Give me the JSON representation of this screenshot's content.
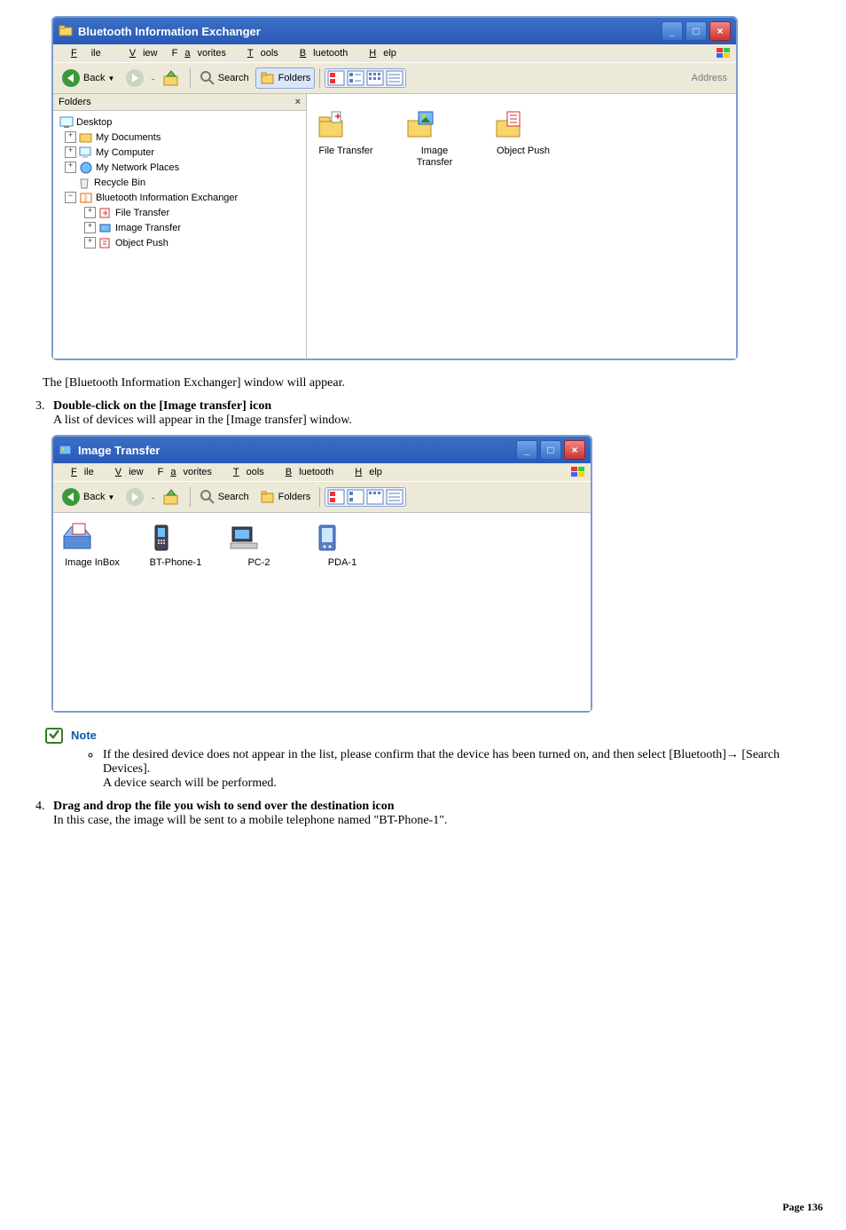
{
  "win1": {
    "title": "Bluetooth Information Exchanger",
    "menu": {
      "file": "File",
      "view": "View",
      "favorites": "Favorites",
      "tools": "Tools",
      "bluetooth": "Bluetooth",
      "help": "Help"
    },
    "toolbar": {
      "back": "Back",
      "search": "Search",
      "folders": "Folders",
      "address": "Address"
    },
    "folders_label": "Folders",
    "tree": {
      "desktop": "Desktop",
      "my_documents": "My Documents",
      "my_computer": "My Computer",
      "my_network": "My Network Places",
      "recycle": "Recycle Bin",
      "bt_exchanger": "Bluetooth Information Exchanger",
      "file_transfer": "File Transfer",
      "image_transfer": "Image Transfer",
      "object_push": "Object Push"
    },
    "items": {
      "file_transfer": "File Transfer",
      "image_transfer": "Image\nTransfer",
      "object_push": "Object Push"
    }
  },
  "caption1": "The [Bluetooth Information Exchanger] window will appear.",
  "step3": {
    "title": "Double-click on the [Image transfer] icon",
    "body": "A list of devices will appear in the [Image transfer] window."
  },
  "win2": {
    "title": "Image Transfer",
    "menu": {
      "file": "File",
      "view": "View",
      "favorites": "Favorites",
      "tools": "Tools",
      "bluetooth": "Bluetooth",
      "help": "Help"
    },
    "toolbar": {
      "back": "Back",
      "search": "Search",
      "folders": "Folders"
    },
    "items": {
      "inbox": "Image InBox",
      "phone": "BT-Phone-1",
      "pc": "PC-2",
      "pda": "PDA-1"
    }
  },
  "note": {
    "label": "Note",
    "body_a": "If the desired device does not appear in the list, please confirm that the device has been turned on, and then select [Bluetooth]→ [Search Devices].",
    "body_b": "A device search will be performed."
  },
  "step4": {
    "title": "Drag and drop the file you wish to send over the destination icon",
    "body": "In this case, the image will be sent to a mobile telephone named \"BT-Phone-1\"."
  },
  "footer": "Page 136"
}
